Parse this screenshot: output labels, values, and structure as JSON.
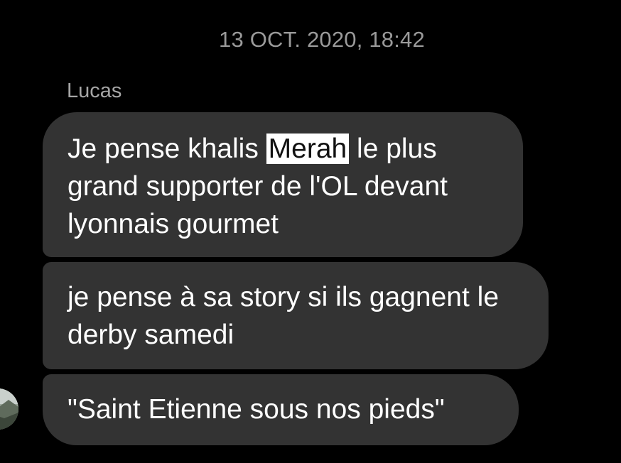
{
  "conversation": {
    "timestamp": "13 OCT. 2020, 18:42",
    "sender": "Lucas",
    "messages": [
      {
        "before": "Je pense khalis ",
        "highlight": "Merah",
        "after": " le plus grand supporter de l'OL devant lyonnais gourmet"
      },
      {
        "text": "je pense à sa story si ils gagnent le derby samedi"
      },
      {
        "text": "\"Saint Etienne sous nos pieds\""
      }
    ]
  },
  "colors": {
    "background": "#000000",
    "bubble": "#333333",
    "timestamp_text": "#9a9a9a",
    "message_text": "#ffffff",
    "highlight_bg": "#ffffff"
  },
  "icons": {
    "avatar": "user-avatar-icon"
  }
}
